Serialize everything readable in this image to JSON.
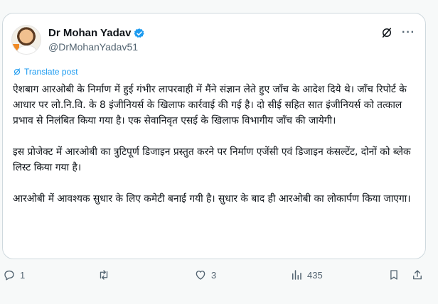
{
  "tweet": {
    "author_name": "Dr Mohan Yadav",
    "handle": "@DrMohanYadav51",
    "translate_label": "Translate post",
    "paragraphs": [
      "ऐशबाग आरओबी के निर्माण में हुई गंभीर लापरवाही में मैंने संज्ञान लेते हुए जाँच के आदेश दिये थे। जाँच रिपोर्ट के आधार पर लो.नि.वि. के 8 इंजीनियर्स के खिलाफ कार्रवाई की गई है। दो सीई सहित सात इंजीनियर्स को तत्काल प्रभाव से निलंबित किया गया है। एक सेवानिवृत एसई के खिलाफ विभागीय जाँच की जायेगी।",
      "इस प्रोजेक्ट में आरओबी का त्रुटिपूर्ण डिजाइन प्रस्तुत करने पर निर्माण एजेंसी एवं डिजाइन कंसल्टेंट, दोनों को ब्लेक लिस्ट किया गया है।",
      "आरओबी में आवश्यक सुधार के लिए कमेटी बनाई गयी है। सुधार के बाद ही आरओबी का लोकार्पण किया जाएगा।"
    ],
    "more_label": "···"
  },
  "actions": {
    "reply_count": "1",
    "repost_count": "",
    "like_count": "3",
    "view_count": "435"
  },
  "colors": {
    "accent": "#1d9bf0",
    "muted": "#536471",
    "text": "#0f1419",
    "border": "#cfd9de",
    "background": "#f7f9f9"
  },
  "icons": [
    "verified-badge-icon",
    "grok-icon",
    "more-icon",
    "translate-icon",
    "reply-icon",
    "repost-icon",
    "like-icon",
    "views-icon",
    "bookmark-icon",
    "share-icon"
  ]
}
